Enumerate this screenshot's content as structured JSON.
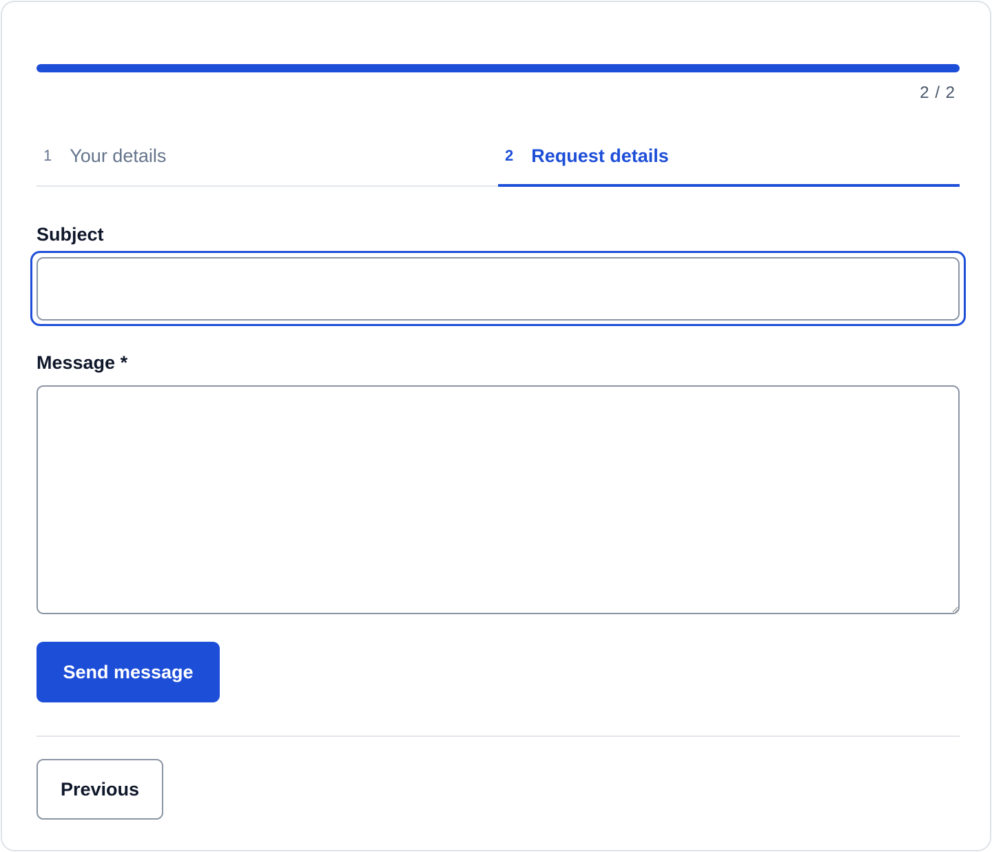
{
  "progress": {
    "fraction": 1.0,
    "counter": "2 / 2"
  },
  "steps": [
    {
      "number": "1",
      "label": "Your details",
      "active": false
    },
    {
      "number": "2",
      "label": "Request details",
      "active": true
    }
  ],
  "form": {
    "subject": {
      "label": "Subject",
      "value": "",
      "placeholder": ""
    },
    "message": {
      "label": "Message *",
      "value": "",
      "placeholder": ""
    }
  },
  "actions": {
    "send_label": "Send message",
    "previous_label": "Previous"
  },
  "colors": {
    "accent": "#1d4ed8",
    "muted_text": "#64748b",
    "border": "#8a94a3"
  }
}
